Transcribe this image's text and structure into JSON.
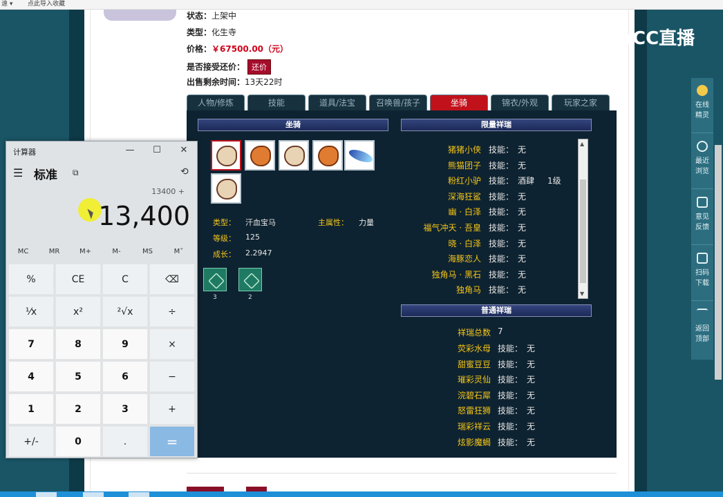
{
  "topbar": {
    "item1": "遠 ▾",
    "item2": "点此导入收藏"
  },
  "info": {
    "status_label": "状态：",
    "status_value": "上架中",
    "type_label": "类型：",
    "type_value": "化生寺",
    "price_label": "价格：",
    "price_value": "￥67500.00（元）",
    "bargain_label": "是否接受还价：",
    "bargain_button": "还价",
    "time_label": "出售剩余时间：",
    "time_value": "13天22时"
  },
  "tabs": [
    "人物/修炼",
    "技能",
    "道具/法宝",
    "召唤兽/孩子",
    "坐骑",
    "锦衣/外观",
    "玩家之家"
  ],
  "mount": {
    "header": "坐骑",
    "type_label": "类型：",
    "type_value": "汗血宝马",
    "attr_label": "主属性：",
    "attr_value": "力量",
    "level_label": "等级：",
    "level_value": "125",
    "growth_label": "成长：",
    "growth_value": "2.2947",
    "skill_counts": [
      "3",
      "2"
    ]
  },
  "limited": {
    "header": "限量祥瑞",
    "skill_label": "技能：",
    "items": [
      {
        "name": "猪猪小侠",
        "skill": "无",
        "level": ""
      },
      {
        "name": "熊猫团子",
        "skill": "无",
        "level": ""
      },
      {
        "name": "粉红小驴",
        "skill": "酒肆",
        "level": "1级"
      },
      {
        "name": "深海狂鲨",
        "skill": "无",
        "level": ""
      },
      {
        "name": "幽 · 白泽",
        "skill": "无",
        "level": ""
      },
      {
        "name": "福气冲天 · 吾皇",
        "skill": "无",
        "level": ""
      },
      {
        "name": "晓 · 白泽",
        "skill": "无",
        "level": ""
      },
      {
        "name": "海豚恋人",
        "skill": "无",
        "level": ""
      },
      {
        "name": "独角马 · 黑石",
        "skill": "无",
        "level": ""
      },
      {
        "name": "独角马",
        "skill": "无",
        "level": ""
      }
    ]
  },
  "normal": {
    "header": "普通祥瑞",
    "total_label": "祥瑞总数",
    "total_value": "7",
    "skill_label": "技能：",
    "items": [
      {
        "name": "荧彩水母",
        "skill": "无"
      },
      {
        "name": "甜蜜豆豆",
        "skill": "无"
      },
      {
        "name": "璀彩灵仙",
        "skill": "无"
      },
      {
        "name": "浣碧石犀",
        "skill": "无"
      },
      {
        "name": "怒雷狂狮",
        "skill": "无"
      },
      {
        "name": "瑞彩祥云",
        "skill": "无"
      },
      {
        "name": "炫影魔蝎",
        "skill": "无"
      }
    ]
  },
  "sidebar": [
    {
      "label": "在线\n精灵",
      "icon": "fairy-icon"
    },
    {
      "label": "最近\n浏览",
      "icon": "clock-icon"
    },
    {
      "label": "意见\n反馈",
      "icon": "edit-icon"
    },
    {
      "label": "扫码\n下载",
      "icon": "scan-icon"
    },
    {
      "label": "返回\n顶部",
      "icon": "arrow-up-icon"
    }
  ],
  "logo": {
    "text": "CC直播"
  },
  "calculator": {
    "title": "计算器",
    "mode": "标准",
    "expression": "13400 +",
    "display": "13,400",
    "memory": [
      "MC",
      "MR",
      "M+",
      "M-",
      "MS",
      "M˅"
    ],
    "keys": [
      [
        "%",
        "CE",
        "C",
        "⌫"
      ],
      [
        "⅟x",
        "x²",
        "²√x",
        "÷"
      ],
      [
        "7",
        "8",
        "9",
        "×"
      ],
      [
        "4",
        "5",
        "6",
        "−"
      ],
      [
        "1",
        "2",
        "3",
        "+"
      ],
      [
        "+/-",
        "0",
        ".",
        "="
      ]
    ]
  }
}
